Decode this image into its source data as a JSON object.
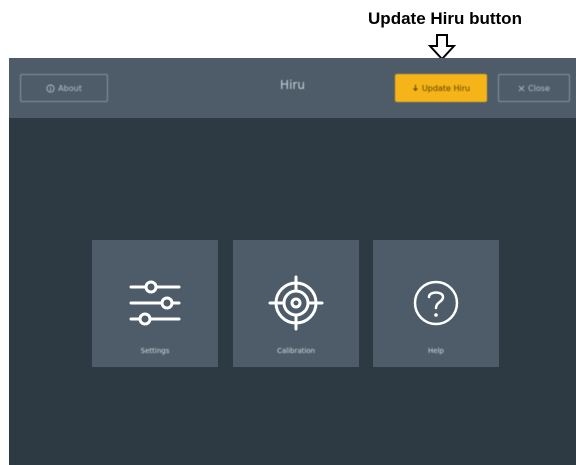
{
  "annotation": {
    "label": "Update Hiru button"
  },
  "toolbar": {
    "about_label": "About",
    "title": "Hiru",
    "update_label": "Update Hiru",
    "close_label": "Close"
  },
  "tiles": [
    {
      "label": "Settings",
      "icon": "sliders-icon"
    },
    {
      "label": "Calibration",
      "icon": "target-icon"
    },
    {
      "label": "Help",
      "icon": "question-icon"
    }
  ],
  "colors": {
    "background": "#2d3a44",
    "toolbar": "#4d5c68",
    "tile": "#4d5c68",
    "accent": "#f5b417"
  }
}
